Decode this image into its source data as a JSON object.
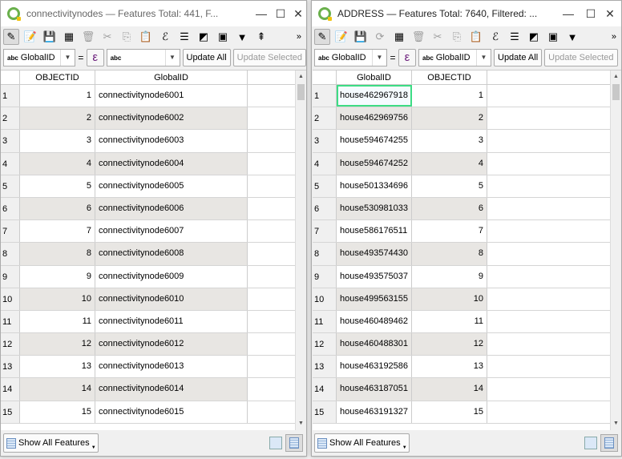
{
  "windows": [
    {
      "title": "connectivitynodes — Features Total: 441, F...",
      "field_combo": "GlobalID",
      "value_combo": "",
      "equals": "=",
      "update_all": "Update All",
      "update_selected": "Update Selected",
      "columns": [
        {
          "label": "OBJECTID",
          "type": "num"
        },
        {
          "label": "GlobalID",
          "type": "text"
        }
      ],
      "rows": [
        [
          "1",
          "1",
          "connectivitynode6001"
        ],
        [
          "2",
          "2",
          "connectivitynode6002"
        ],
        [
          "3",
          "3",
          "connectivitynode6003"
        ],
        [
          "4",
          "4",
          "connectivitynode6004"
        ],
        [
          "5",
          "5",
          "connectivitynode6005"
        ],
        [
          "6",
          "6",
          "connectivitynode6006"
        ],
        [
          "7",
          "7",
          "connectivitynode6007"
        ],
        [
          "8",
          "8",
          "connectivitynode6008"
        ],
        [
          "9",
          "9",
          "connectivitynode6009"
        ],
        [
          "10",
          "10",
          "connectivitynode6010"
        ],
        [
          "11",
          "11",
          "connectivitynode6011"
        ],
        [
          "12",
          "12",
          "connectivitynode6012"
        ],
        [
          "13",
          "13",
          "connectivitynode6013"
        ],
        [
          "14",
          "14",
          "connectivitynode6014"
        ],
        [
          "15",
          "15",
          "connectivitynode6015"
        ]
      ],
      "show_all": "Show All Features",
      "toolbar": [
        "pencil-icon",
        "multi-edit-icon",
        "save-icon",
        "add-row-icon",
        "delete-icon",
        "cut-icon",
        "copy-icon",
        "paste-icon",
        "expression-select-icon",
        "select-all-icon",
        "invert-selection-icon",
        "deselect-icon",
        "filter-icon",
        "move-to-top-icon"
      ]
    },
    {
      "title": "ADDRESS — Features Total: 7640, Filtered: ...",
      "field_combo": "GlobalID",
      "value_combo": "GlobalID",
      "equals": "=",
      "update_all": "Update All",
      "update_selected": "Update Selected",
      "columns": [
        {
          "label": "GlobalID",
          "type": "text"
        },
        {
          "label": "OBJECTID",
          "type": "num"
        }
      ],
      "rows": [
        [
          "1",
          "house462967918",
          "1"
        ],
        [
          "2",
          "house462969756",
          "2"
        ],
        [
          "3",
          "house594674255",
          "3"
        ],
        [
          "4",
          "house594674252",
          "4"
        ],
        [
          "5",
          "house501334696",
          "5"
        ],
        [
          "6",
          "house530981033",
          "6"
        ],
        [
          "7",
          "house586176511",
          "7"
        ],
        [
          "8",
          "house493574430",
          "8"
        ],
        [
          "9",
          "house493575037",
          "9"
        ],
        [
          "10",
          "house499563155",
          "10"
        ],
        [
          "11",
          "house460489462",
          "11"
        ],
        [
          "12",
          "house460488301",
          "12"
        ],
        [
          "13",
          "house463192586",
          "13"
        ],
        [
          "14",
          "house463187051",
          "14"
        ],
        [
          "15",
          "house463191327",
          "15"
        ]
      ],
      "show_all": "Show All Features",
      "toolbar": [
        "pencil-icon",
        "multi-edit-icon",
        "save-icon",
        "reload-icon",
        "add-row-icon",
        "delete-icon",
        "cut-icon",
        "copy-icon",
        "paste-icon",
        "expression-select-icon",
        "select-all-icon",
        "invert-selection-icon",
        "deselect-icon",
        "filter-icon"
      ]
    }
  ],
  "common": {
    "abc": "abc",
    "epsilon": "ε",
    "more": "»",
    "minimize": "—",
    "maximize": "☐",
    "close": "✕"
  }
}
